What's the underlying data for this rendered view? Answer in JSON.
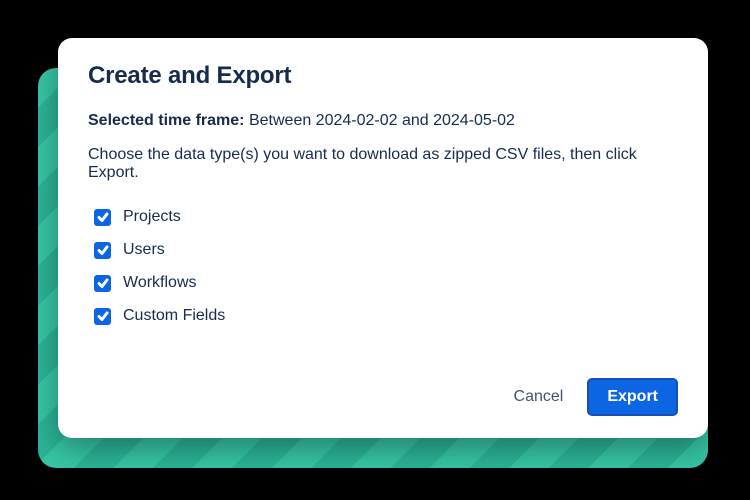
{
  "dialog": {
    "title": "Create and Export",
    "timeframe_label": "Selected time frame:",
    "timeframe_value": "Between 2024-02-02 and 2024-05-02",
    "instruction": "Choose the data type(s) you want to download as zipped CSV files, then click Export.",
    "options": [
      {
        "label": "Projects",
        "checked": true
      },
      {
        "label": "Users",
        "checked": true
      },
      {
        "label": "Workflows",
        "checked": true
      },
      {
        "label": "Custom Fields",
        "checked": true
      }
    ],
    "cancel_label": "Cancel",
    "export_label": "Export"
  },
  "colors": {
    "primary": "#0c66e4",
    "text": "#172b4d"
  }
}
